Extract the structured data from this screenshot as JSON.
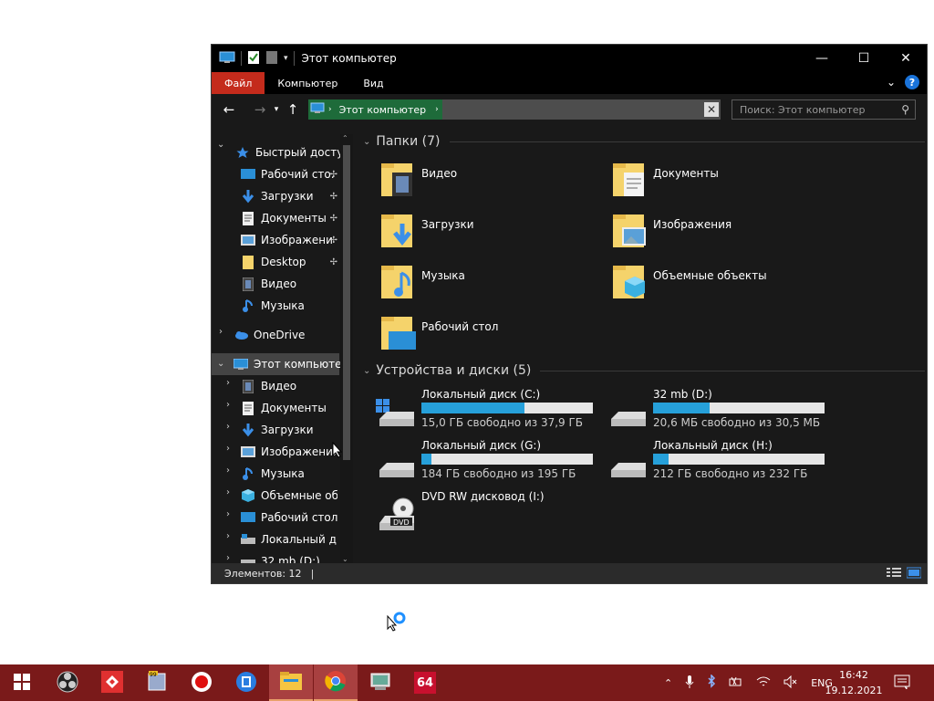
{
  "window": {
    "title": "Этот компьютер",
    "ribbon_tabs": [
      "Файл",
      "Компьютер",
      "Вид"
    ],
    "address": "Этот компьютер",
    "search_placeholder": "Поиск: Этот компьютер",
    "status_text": "Элементов: 12"
  },
  "nav": {
    "quick_access": "Быстрый доступ",
    "quick_items": [
      {
        "label": "Рабочий сто.",
        "icon": "desktop-icon",
        "pinned": true
      },
      {
        "label": "Загрузки",
        "icon": "downloads-icon",
        "pinned": true
      },
      {
        "label": "Документы",
        "icon": "documents-icon",
        "pinned": true
      },
      {
        "label": "Изображени",
        "icon": "pictures-icon",
        "pinned": true
      },
      {
        "label": "Desktop",
        "icon": "folder-icon",
        "pinned": true
      },
      {
        "label": "Видео",
        "icon": "video-icon",
        "pinned": false
      },
      {
        "label": "Музыка",
        "icon": "music-icon",
        "pinned": false
      }
    ],
    "onedrive": "OneDrive",
    "this_pc": "Этот компьютер",
    "pc_items": [
      {
        "label": "Видео",
        "icon": "video-icon"
      },
      {
        "label": "Документы",
        "icon": "documents-icon"
      },
      {
        "label": "Загрузки",
        "icon": "downloads-icon"
      },
      {
        "label": "Изображения",
        "icon": "pictures-icon"
      },
      {
        "label": "Музыка",
        "icon": "music-icon"
      },
      {
        "label": "Объемные объ",
        "icon": "3d-objects-icon"
      },
      {
        "label": "Рабочий стол",
        "icon": "desktop-icon"
      },
      {
        "label": "Локальный дис",
        "icon": "local-disk-icon"
      },
      {
        "label": "32 mb (D:)",
        "icon": "drive-icon"
      }
    ]
  },
  "content": {
    "folders_header": "Папки (7)",
    "folders": [
      {
        "label": "Видео",
        "icon": "video-folder-icon"
      },
      {
        "label": "Документы",
        "icon": "documents-folder-icon"
      },
      {
        "label": "Загрузки",
        "icon": "downloads-folder-icon"
      },
      {
        "label": "Изображения",
        "icon": "pictures-folder-icon"
      },
      {
        "label": "Музыка",
        "icon": "music-folder-icon"
      },
      {
        "label": "Объемные объекты",
        "icon": "3d-objects-folder-icon"
      },
      {
        "label": "Рабочий стол",
        "icon": "desktop-folder-icon"
      }
    ],
    "drives_header": "Устройства и диски (5)",
    "drives": [
      {
        "name": "Локальный диск (C:)",
        "free": "15,0 ГБ свободно из 37,9 ГБ",
        "used_fraction": 0.6,
        "icon": "windows-drive-icon"
      },
      {
        "name": "32 mb (D:)",
        "free": "20,6 МБ свободно из 30,5 МБ",
        "used_fraction": 0.33,
        "icon": "drive-icon"
      },
      {
        "name": "Локальный диск (G:)",
        "free": "184 ГБ свободно из 195 ГБ",
        "used_fraction": 0.06,
        "icon": "drive-icon"
      },
      {
        "name": "Локальный диск (H:)",
        "free": "212 ГБ свободно из 232 ГБ",
        "used_fraction": 0.09,
        "icon": "drive-icon"
      },
      {
        "name": "DVD RW дисковод (I:)",
        "free": "",
        "used_fraction": null,
        "icon": "dvd-drive-icon"
      }
    ]
  },
  "taskbar": {
    "apps": [
      "start-icon",
      "obs-icon",
      "app-red-icon",
      "notepad-icon",
      "record-icon",
      "video-editor-icon",
      "explorer-icon",
      "chrome-icon",
      "control-panel-icon",
      "aida64-icon"
    ],
    "aida_label": "64",
    "language": "ENG",
    "time": "16:42",
    "date": "19.12.2021"
  },
  "colors": {
    "accent": "#26a0da",
    "file_tab": "#c42b1c",
    "taskbar": "#7a1a1a",
    "selected_addr": "#1e6b3a"
  }
}
